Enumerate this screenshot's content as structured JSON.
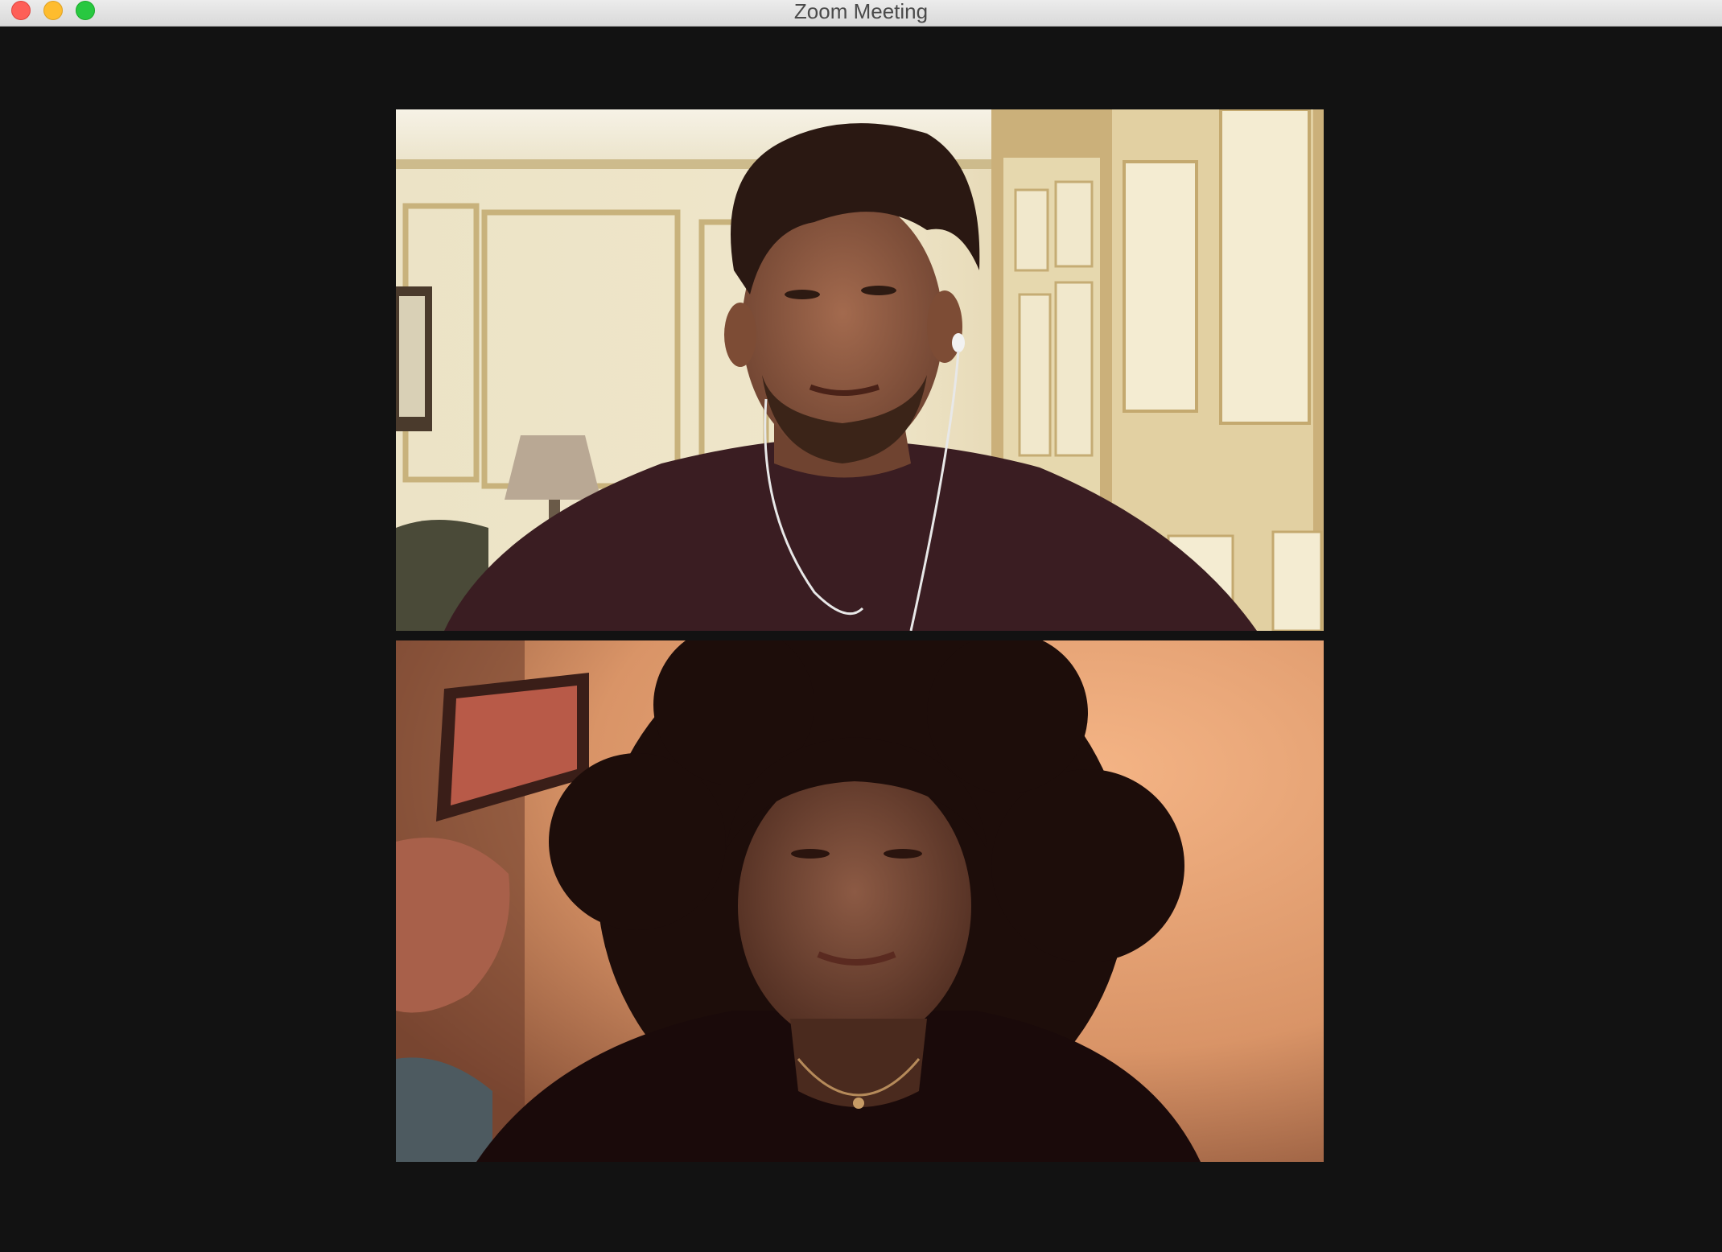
{
  "window": {
    "title": "Zoom Meeting"
  },
  "controls": {
    "close": "close-icon",
    "minimize": "minimize-icon",
    "zoom": "zoom-icon"
  },
  "colors": {
    "background": "#121212",
    "titlebar": "#e3e3e3",
    "close": "#fe5f57",
    "minimize": "#febc2e",
    "zoom": "#28c840"
  },
  "participants": [
    {
      "video": "man-with-earphones-video"
    },
    {
      "video": "woman-with-curly-hair-video"
    }
  ]
}
